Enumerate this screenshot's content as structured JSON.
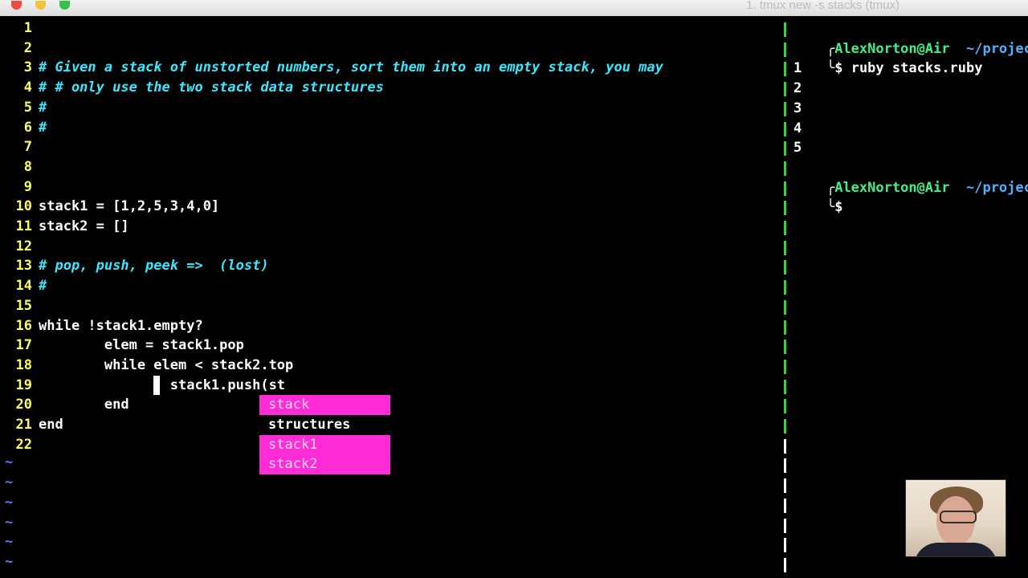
{
  "window": {
    "title": "1. tmux new -s stacks (tmux)"
  },
  "editor": {
    "lines": [
      {
        "num": "1",
        "text": "",
        "comment": false
      },
      {
        "num": "2",
        "text": "",
        "comment": false
      },
      {
        "num": "3",
        "text": "# Given a stack of unstorted numbers, sort them into an empty stack, you may",
        "comment": true
      },
      {
        "num": "4",
        "text": "# # only use the two stack data structures",
        "comment": true
      },
      {
        "num": "5",
        "text": "#",
        "comment": true
      },
      {
        "num": "6",
        "text": "#",
        "comment": true
      },
      {
        "num": "7",
        "text": "",
        "comment": false
      },
      {
        "num": "8",
        "text": "",
        "comment": false
      },
      {
        "num": "9",
        "text": "",
        "comment": false
      },
      {
        "num": "10",
        "text": "stack1 = [1,2,5,3,4,0]",
        "comment": false
      },
      {
        "num": "11",
        "text": "stack2 = []",
        "comment": false
      },
      {
        "num": "12",
        "text": "",
        "comment": false
      },
      {
        "num": "13",
        "text": "# pop, push, peek =>  (lost)",
        "comment": true
      },
      {
        "num": "14",
        "text": "#",
        "comment": true
      },
      {
        "num": "15",
        "text": "",
        "comment": false
      },
      {
        "num": "16",
        "text": "while !stack1.empty?",
        "comment": false
      },
      {
        "num": "17",
        "text": "        elem = stack1.pop",
        "comment": false
      },
      {
        "num": "18",
        "text": "        while elem < stack2.top",
        "comment": false
      },
      {
        "num": "19",
        "text": "                stack1.push(st",
        "comment": false
      },
      {
        "num": "20",
        "text": "        end",
        "comment": false
      },
      {
        "num": "21",
        "text": "end",
        "comment": false
      },
      {
        "num": "22",
        "text": "",
        "comment": false
      }
    ],
    "tildes": [
      "~",
      "~",
      "~",
      "~",
      "~",
      "~"
    ]
  },
  "completion": {
    "items": [
      {
        "label": "stack",
        "selected": false
      },
      {
        "label": "structures",
        "selected": true
      },
      {
        "label": "stack1",
        "selected": false
      },
      {
        "label": "stack2",
        "selected": false
      }
    ]
  },
  "terminal": {
    "prompt1": {
      "corner": "╭",
      "user": "AlexNorton@Air",
      "path": "~/projects"
    },
    "command_line": {
      "corner": "╰",
      "dollar": "$",
      "command": "ruby stacks.ruby"
    },
    "output": [
      "1",
      "2",
      "3",
      "4",
      "5"
    ],
    "prompt2": {
      "corner": "╭",
      "user": "AlexNorton@Air",
      "path": "~/projects"
    },
    "prompt2_line": {
      "corner": "╰",
      "dollar": "$"
    }
  },
  "colors": {
    "line_number": "#ffff5a",
    "comment": "#38e8ff",
    "popup": "#ff2bd7",
    "prompt_user": "#3ff08a",
    "prompt_path": "#4fb2ff",
    "divider_active": "#3ccf4a",
    "divider_inactive": "#ffffff"
  }
}
